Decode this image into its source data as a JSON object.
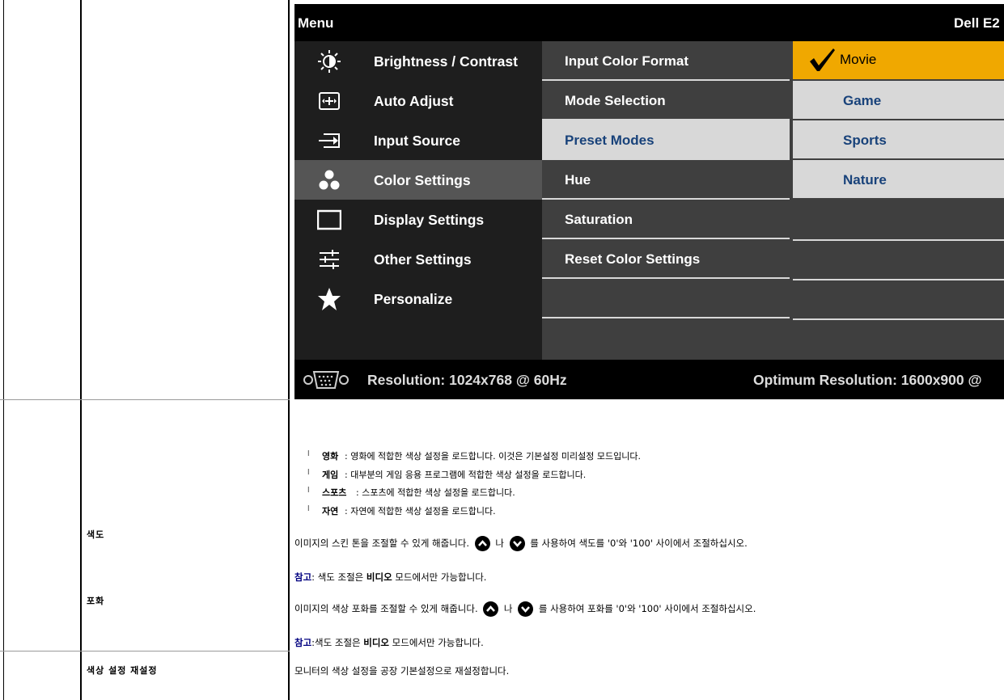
{
  "osd": {
    "menu_title": "Menu",
    "brand": "Dell E2",
    "menu_items": [
      {
        "label": "Brightness / Contrast",
        "icon": "brightness-icon"
      },
      {
        "label": "Auto Adjust",
        "icon": "auto-adjust-icon"
      },
      {
        "label": "Input Source",
        "icon": "input-source-icon"
      },
      {
        "label": "Color Settings",
        "icon": "color-settings-icon"
      },
      {
        "label": "Display Settings",
        "icon": "display-settings-icon"
      },
      {
        "label": "Other Settings",
        "icon": "other-settings-icon"
      },
      {
        "label": "Personalize",
        "icon": "star-icon"
      }
    ],
    "active_menu": "Color Settings",
    "sub_items": [
      "Input Color Format",
      "Mode Selection",
      "Preset Modes",
      "Hue",
      "Saturation",
      "Reset Color Settings"
    ],
    "highlighted_sub": "Preset Modes",
    "options": [
      "Movie",
      "Game",
      "Sports",
      "Nature"
    ],
    "selected_option": "Movie",
    "resolution": "Resolution: 1024x768 @ 60Hz",
    "optimum_resolution": "Optimum Resolution: 1600x900 @",
    "colors": {
      "selected_bg": "#f0a800",
      "highlight_bg": "#d8d8d8",
      "highlight_text": "#18427a",
      "active_menu_bg": "#555555"
    }
  },
  "preset_bullets": [
    {
      "term": "영화",
      "text": ": 영화에 적합한 색상 설정을 로드합니다. 이것은 기본설정 미리설정 모드입니다."
    },
    {
      "term": "게임",
      "text": ": 대부분의 게임 응용 프로그램에 적합한 색상 설정을 로드합니다."
    },
    {
      "term": "스포츠",
      "text": ": 스포츠에 적합한 색상 설정을 로드합니다."
    },
    {
      "term": "자연",
      "text": ": 자연에 적합한 색상 설정을 로드합니다."
    }
  ],
  "rows": {
    "hue": {
      "label": "색도",
      "desc_before": "이미지의 스킨 톤을 조절할 수 있게 해줍니다.",
      "desc_mid": "나",
      "desc_after": "를 사용하여 색도를 '0'와 '100' 사이에서 조절하십시오.",
      "note_label": "참고",
      "note_before": ": 색도 조절은",
      "note_bold": "비디오",
      "note_after": "모드에서만 가능합니다."
    },
    "saturation": {
      "label": "포화",
      "desc_before": "이미지의 색상 포화를 조절할 수 있게 해줍니다.",
      "desc_mid": "나",
      "desc_after": "를 사용하여 포화를 '0'와 '100' 사이에서 조절하십시오.",
      "note_label": "참고",
      "note_before": ":색도 조절은",
      "note_bold": "비디오",
      "note_after": "모드에서만 가능합니다."
    },
    "reset": {
      "label": "색상 설정 재설정",
      "desc": "모니터의 색상 설정을 공장 기본설정으로 재설정합니다."
    }
  }
}
